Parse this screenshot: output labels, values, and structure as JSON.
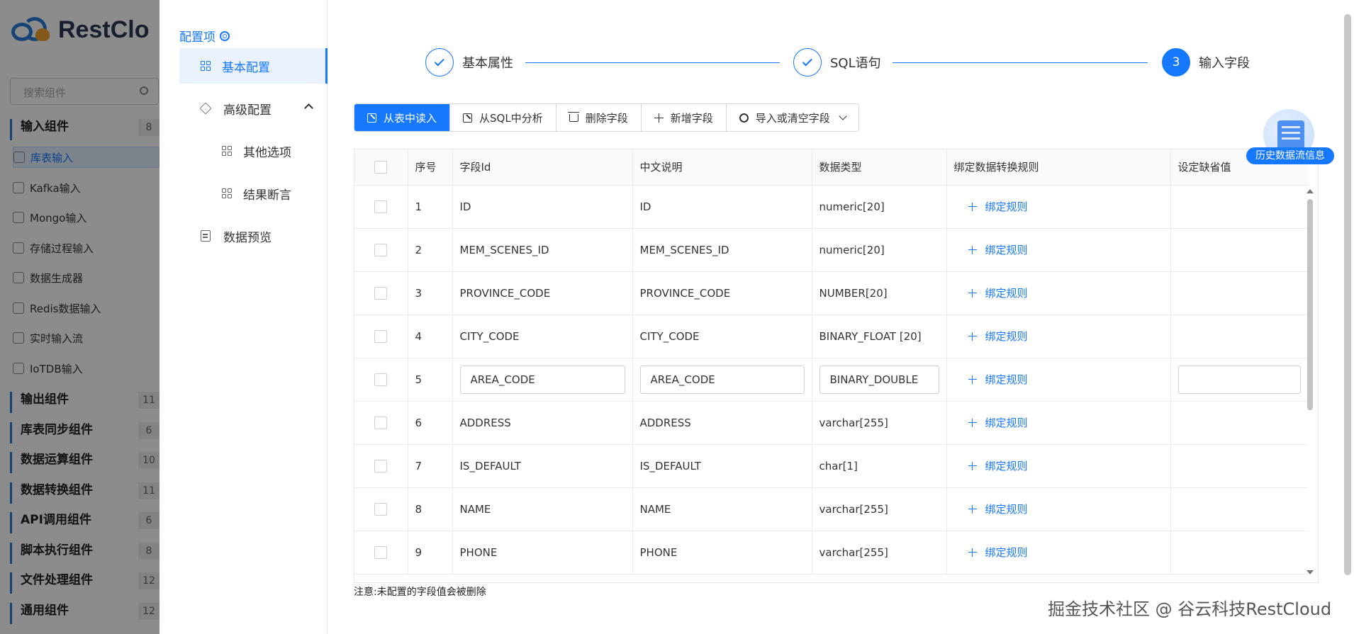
{
  "background_app": {
    "logo_text": "RestClo",
    "search_placeholder": "搜索组件",
    "groups": [
      {
        "label": "输入组件",
        "count": "8"
      },
      {
        "label": "输出组件",
        "count": "11"
      },
      {
        "label": "库表同步组件",
        "count": "6"
      },
      {
        "label": "数据运算组件",
        "count": "10"
      },
      {
        "label": "数据转换组件",
        "count": "11"
      },
      {
        "label": "API调用组件",
        "count": "6"
      },
      {
        "label": "脚本执行组件",
        "count": "8"
      },
      {
        "label": "文件处理组件",
        "count": "12"
      },
      {
        "label": "通用组件",
        "count": "12"
      }
    ],
    "input_items": [
      "库表输入",
      "Kafka输入",
      "Mongo输入",
      "存储过程输入",
      "数据生成器",
      "Redis数据输入",
      "实时输入流",
      "IoTDB输入"
    ]
  },
  "config_nav": {
    "title": "配置项",
    "items": [
      {
        "label": "基本配置"
      },
      {
        "label": "高级配置"
      },
      {
        "label": "其他选项"
      },
      {
        "label": "结果断言"
      },
      {
        "label": "数据预览"
      }
    ]
  },
  "stepper": {
    "steps": [
      {
        "label": "基本属性",
        "status": "done"
      },
      {
        "label": "SQL语句",
        "status": "done"
      },
      {
        "label": "输入字段",
        "status": "current",
        "number": "3"
      }
    ]
  },
  "toolbar": {
    "read_from_table": "从表中读入",
    "analyze_sql": "从SQL中分析",
    "delete_field": "删除字段",
    "add_field": "新增字段",
    "import_clear": "导入或清空字段"
  },
  "table": {
    "headers": [
      "序号",
      "字段Id",
      "中文说明",
      "数据类型",
      "绑定数据转换规则",
      "设定缺省值"
    ],
    "bind_label": "绑定规则",
    "rows": [
      {
        "no": "1",
        "field_id": "ID",
        "desc": "ID",
        "type": "numeric[20]",
        "default": ""
      },
      {
        "no": "2",
        "field_id": "MEM_SCENES_ID",
        "desc": "MEM_SCENES_ID",
        "type": "numeric[20]",
        "default": ""
      },
      {
        "no": "3",
        "field_id": "PROVINCE_CODE",
        "desc": "PROVINCE_CODE",
        "type": "NUMBER[20]",
        "default": ""
      },
      {
        "no": "4",
        "field_id": "CITY_CODE",
        "desc": "CITY_CODE",
        "type": "BINARY_FLOAT [20]",
        "default": ""
      },
      {
        "no": "5",
        "field_id": "AREA_CODE",
        "desc": "AREA_CODE",
        "type": "BINARY_DOUBLE",
        "default": "",
        "editing": true
      },
      {
        "no": "6",
        "field_id": "ADDRESS",
        "desc": "ADDRESS",
        "type": "varchar[255]",
        "default": ""
      },
      {
        "no": "7",
        "field_id": "IS_DEFAULT",
        "desc": "IS_DEFAULT",
        "type": "char[1]",
        "default": ""
      },
      {
        "no": "8",
        "field_id": "NAME",
        "desc": "NAME",
        "type": "varchar[255]",
        "default": ""
      },
      {
        "no": "9",
        "field_id": "PHONE",
        "desc": "PHONE",
        "type": "varchar[255]",
        "default": ""
      }
    ]
  },
  "note": "注意:未配置的字段值会被删除",
  "history_badge": "历史数据流信息",
  "watermark": "掘金技术社区 @ 谷云科技RestCloud",
  "colors": {
    "accent": "#1677ff",
    "active_nav_bg": "#eaf2ff"
  }
}
